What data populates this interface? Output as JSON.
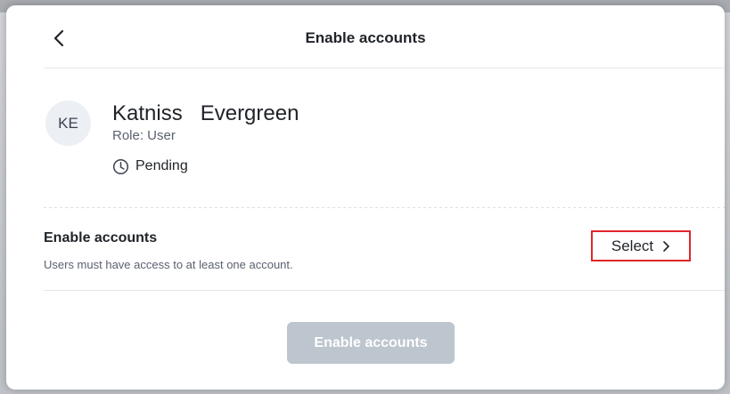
{
  "header": {
    "title": "Enable accounts",
    "back_icon": "chevron-left-icon"
  },
  "user": {
    "initials": "KE",
    "name": "Katniss   Evergreen",
    "role": "Role: User",
    "status": "Pending",
    "status_icon": "clock-icon"
  },
  "accounts_section": {
    "title": "Enable accounts",
    "subtitle": "Users must have access to at least one account.",
    "select_label": "Select",
    "select_icon": "chevron-right-icon",
    "highlight_color": "#e0262b"
  },
  "footer": {
    "primary_label": "Enable accounts",
    "primary_disabled": true,
    "primary_color": "#bdc5ce"
  }
}
